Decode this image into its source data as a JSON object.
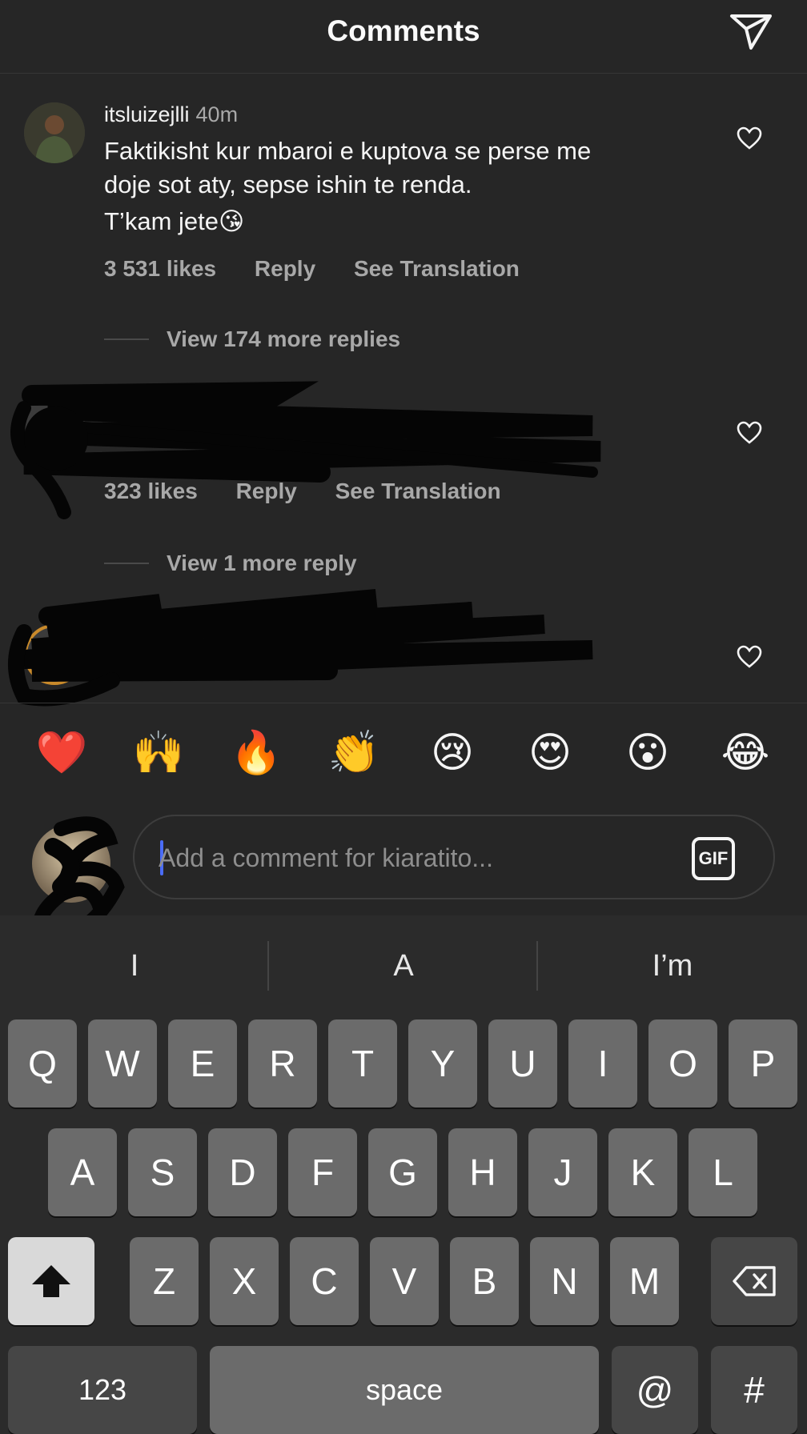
{
  "header": {
    "title": "Comments"
  },
  "comments": [
    {
      "username": "itsluizejlli",
      "time": "40m",
      "text_lines": [
        "Faktikisht kur mbaroi e kuptova se perse me",
        "doje sot aty, sepse ishin te renda.",
        "T’kam jete😘"
      ],
      "likes": "3 531 likes",
      "reply": "Reply",
      "see_translation": "See Translation",
      "view_replies": "View 174 more replies"
    },
    {
      "likes": "323 likes",
      "reply": "Reply",
      "see_translation": "See Translation",
      "view_replies": "View 1 more reply"
    }
  ],
  "reactions": [
    "❤️",
    "🙌",
    "🔥",
    "👏",
    "😢",
    "😍",
    "😮",
    "😂"
  ],
  "composer": {
    "placeholder": "Add a comment for kiaratito...",
    "gif_label": "GIF"
  },
  "keyboard": {
    "suggestions": [
      "I",
      "A",
      "I’m"
    ],
    "row1": [
      "Q",
      "W",
      "E",
      "R",
      "T",
      "Y",
      "U",
      "I",
      "O",
      "P"
    ],
    "row2": [
      "A",
      "S",
      "D",
      "F",
      "G",
      "H",
      "J",
      "K",
      "L"
    ],
    "row3": [
      "Z",
      "X",
      "C",
      "V",
      "B",
      "N",
      "M"
    ],
    "numbers_label": "123",
    "space_label": "space",
    "at_label": "@",
    "hash_label": "#"
  },
  "colors": {
    "background": "#262626",
    "muted": "#a8a8a8",
    "caret": "#4a6cf7",
    "keyboard_key": "#6b6b6b"
  }
}
